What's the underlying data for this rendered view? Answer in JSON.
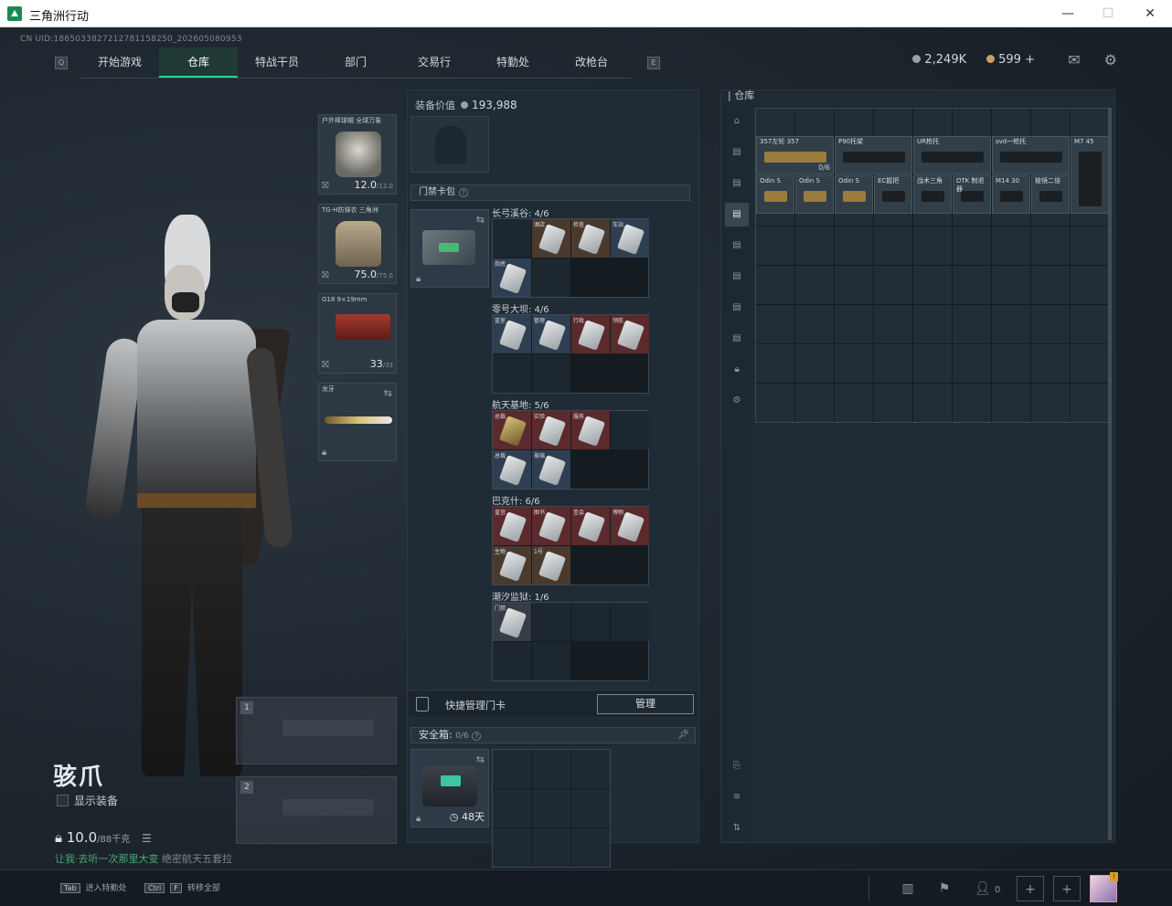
{
  "window": {
    "title": "三角洲行动",
    "minimize": "—",
    "maximize": "☐",
    "close": "✕"
  },
  "uid": "CN UID:1865033827212781158250_202605080953",
  "nav": {
    "tabs": [
      {
        "label": "开始游戏",
        "active": false,
        "badge": ""
      },
      {
        "label": "仓库",
        "active": true,
        "badge": ""
      },
      {
        "label": "特战干员",
        "active": false,
        "badge": "!"
      },
      {
        "label": "部门",
        "active": false,
        "badge": ""
      },
      {
        "label": "交易行",
        "active": false,
        "badge": ""
      },
      {
        "label": "特勤处",
        "active": false,
        "badge": "!"
      },
      {
        "label": "改枪台",
        "active": false,
        "badge": ""
      }
    ],
    "left_key": "Q",
    "right_key": "E"
  },
  "currency": {
    "silver": "2,249K",
    "gold": "599",
    "plus": "+"
  },
  "top_icons": {
    "mail": "✉",
    "settings": "⚙"
  },
  "operator": {
    "name": "骇爪",
    "show_equipment": "显示装备",
    "weight": "10.0",
    "weight_max": "/88千克",
    "objective_prefix": "让我·去听一次那里大变",
    "objective_rest": "绝密航天五套拉"
  },
  "equipment": {
    "helmet": {
      "name": "户外棒球帽 全球万象",
      "value": "12.0",
      "max": "/12.0"
    },
    "armor": {
      "name": "TG-H防弹衣 三角洲",
      "value": "75.0",
      "max": "/75.0"
    },
    "pistol": {
      "name": "G18 9×19mm",
      "value": "33",
      "max": "/33"
    },
    "melee": {
      "name": "龙牙"
    },
    "primary_slots": [
      "1",
      "2"
    ]
  },
  "loadout": {
    "value_label": "装备价值",
    "value": "193,988",
    "keycard_label": "门禁卡包",
    "keycard_groups": [
      {
        "label": "长弓溪谷: 4/6",
        "cells": [
          [
            "empty",
            ""
          ],
          [
            "c-brown",
            "酒店"
          ],
          [
            "c-brown",
            "检查"
          ],
          [
            "c-blue",
            "车站"
          ],
          [
            "c-blue",
            "指挥"
          ],
          [
            "empty",
            ""
          ]
        ]
      },
      {
        "label": "零号大坝: 4/6",
        "cells": [
          [
            "c-blue",
            "蓝室"
          ],
          [
            "c-blue",
            "管理"
          ],
          [
            "c-red",
            "行政"
          ],
          [
            "c-red",
            "领航"
          ],
          [
            "empty",
            ""
          ],
          [
            "empty",
            ""
          ]
        ]
      },
      {
        "label": "航天基地: 5/6",
        "cells": [
          [
            "c-red",
            "总裁"
          ],
          [
            "c-red",
            "实验"
          ],
          [
            "c-red",
            "服务"
          ],
          [
            "empty",
            ""
          ],
          [
            "c-blue",
            "总裁"
          ],
          [
            "c-blue",
            "玻璃"
          ]
        ]
      },
      {
        "label": "巴克什: 6/6",
        "cells": [
          [
            "c-red",
            "皇宫"
          ],
          [
            "c-red",
            "图书"
          ],
          [
            "c-red",
            "圣会"
          ],
          [
            "c-red",
            "博物"
          ],
          [
            "c-brown",
            "生物"
          ],
          [
            "c-brown",
            "1号"
          ]
        ]
      },
      {
        "label": "潮汐监狱: 1/6",
        "cells": [
          [
            "c-grey",
            "门禁"
          ],
          [
            "empty",
            ""
          ],
          [
            "empty",
            ""
          ],
          [
            "empty",
            ""
          ],
          [
            "empty",
            ""
          ],
          [
            "empty",
            ""
          ]
        ]
      }
    ],
    "quick_manage": "快捷管理门卡",
    "manage_button": "管理",
    "safe_label": "安全箱:",
    "safe_count": "0/6",
    "safe_days": "48天"
  },
  "stash": {
    "title": "仓库",
    "items": [
      {
        "name": "357左轮 357",
        "qty": "0/6"
      },
      {
        "name": "P90托架",
        "qty": ""
      },
      {
        "name": "UR枪托",
        "qty": ""
      },
      {
        "name": "svd一枪托",
        "qty": ""
      },
      {
        "name": "M7 45",
        "qty": ""
      },
      {
        "name": "Odin S",
        "qty": ""
      },
      {
        "name": "Odin S",
        "qty": ""
      },
      {
        "name": "Odin S",
        "qty": ""
      },
      {
        "name": "EC握把",
        "qty": ""
      },
      {
        "name": "战术三角",
        "qty": ""
      },
      {
        "name": "DTK 制退器",
        "qty": ""
      },
      {
        "name": "M14 30",
        "qty": ""
      },
      {
        "name": "棱镜二倍",
        "qty": ""
      }
    ]
  },
  "bottom": {
    "hotkey1_key": "Tab",
    "hotkey1_text": "进入特勤处",
    "hotkey2_key": "Ctrl",
    "hotkey2_key2": "F",
    "hotkey2_text": "转移全部",
    "friends": "0",
    "avatar_badge": "!"
  }
}
